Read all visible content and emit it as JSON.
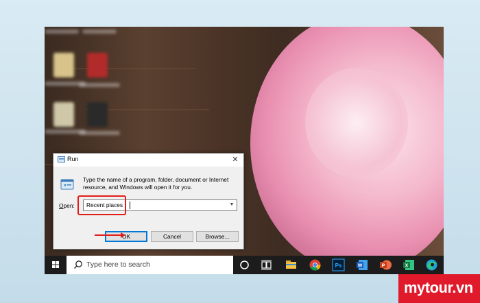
{
  "run_dialog": {
    "title": "Run",
    "description": "Type the name of a program, folder, document or Internet resource, and Windows will open it for you.",
    "open_label": "Open:",
    "input_value": "Recent places",
    "ok_label": "OK",
    "cancel_label": "Cancel",
    "browse_label": "Browse..."
  },
  "taskbar": {
    "search_placeholder": "Type here to search",
    "pinned": [
      "task-view",
      "file-explorer",
      "chrome",
      "photoshop",
      "word",
      "powerpoint",
      "excel",
      "edge"
    ]
  },
  "watermark": "mytour.vn",
  "colors": {
    "highlight": "#e21b1b",
    "taskbar": "#1c1c1c",
    "brand": "#e0192b"
  }
}
